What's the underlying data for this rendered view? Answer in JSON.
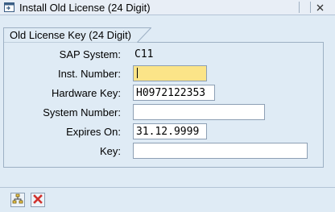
{
  "window": {
    "title": "Install Old License (24 Digit)",
    "title_icon": "window-icon",
    "close_icon": "close-icon"
  },
  "group": {
    "title": "Old License Key (24 Digit)"
  },
  "fields": {
    "sap_system": {
      "label": "SAP System:",
      "value": "C11"
    },
    "inst_number": {
      "label": "Inst. Number:",
      "value": ""
    },
    "hardware_key": {
      "label": "Hardware Key:",
      "value": "H0972122353"
    },
    "system_number": {
      "label": "System Number:",
      "value": ""
    },
    "expires_on": {
      "label": "Expires On:",
      "value": "31.12.9999"
    },
    "key": {
      "label": "Key:",
      "value": ""
    }
  },
  "toolbar": {
    "execute_icon": "hierarchy-icon",
    "cancel_icon": "cancel-icon"
  },
  "colors": {
    "background": "#dfebf5",
    "required_field": "#fbe488",
    "cancel_red": "#d0312d"
  }
}
